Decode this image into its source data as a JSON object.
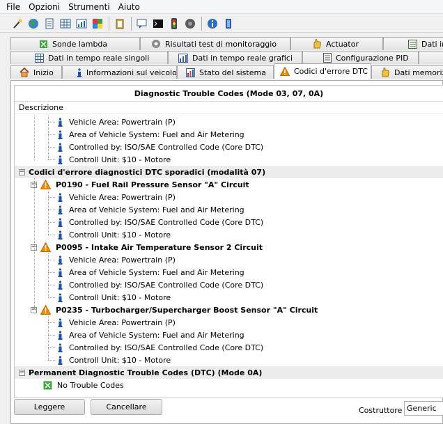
{
  "menu": [
    "File",
    "Opzioni",
    "Strumenti",
    "Aiuto"
  ],
  "toolbar_icons": [
    "wand-icon",
    "globe-icon",
    "document-icon",
    "grid-icon",
    "chart-icon",
    "color-palette-icon",
    "clipboard-icon",
    "chat-icon",
    "terminal-icon",
    "traffic-light-icon",
    "record-icon",
    "info-icon",
    "exit-icon"
  ],
  "tabs": {
    "row1": [
      "Sonde lambda",
      "Risultati test di monitoraggio",
      "Actuator",
      "Dati in"
    ],
    "row2": [
      "Dati in tempo reale singoli",
      "Dati in tempo reale grafici",
      "Configurazione PID",
      ""
    ],
    "row3": [
      "Inizio",
      "Informazioni sul veicolo",
      "Stato del sistema",
      "Codici d'errore DTC",
      "Dati memorizzati"
    ]
  },
  "tree": {
    "title": "Diagnostic Trouble Codes (Mode 03, 07, 0A)",
    "column": "Descrizione",
    "rows": [
      {
        "kind": "info",
        "text": "Vehicle Area: Powertrain (P)"
      },
      {
        "kind": "info",
        "text": "Area of Vehicle System: Fuel and Air Metering"
      },
      {
        "kind": "info",
        "text": "Controlled by: ISO/SAE Controlled Code (Core DTC)"
      },
      {
        "kind": "info",
        "text": "Controll Unit: $10 - Motore"
      },
      {
        "kind": "group",
        "text": "Codici d'errore diagnostici DTC sporadici (modalità 07)"
      },
      {
        "kind": "code",
        "text": "P0190 - Fuel Rail Pressure Sensor \"A\" Circuit"
      },
      {
        "kind": "info",
        "text": "Vehicle Area: Powertrain (P)"
      },
      {
        "kind": "info",
        "text": "Area of Vehicle System: Fuel and Air Metering"
      },
      {
        "kind": "info",
        "text": "Controlled by: ISO/SAE Controlled Code (Core DTC)"
      },
      {
        "kind": "info",
        "text": "Controll Unit: $10 - Motore"
      },
      {
        "kind": "code",
        "text": "P0095 - Intake Air Temperature Sensor 2 Circuit"
      },
      {
        "kind": "info",
        "text": "Vehicle Area: Powertrain (P)"
      },
      {
        "kind": "info",
        "text": "Area of Vehicle System: Fuel and Air Metering"
      },
      {
        "kind": "info",
        "text": "Controlled by: ISO/SAE Controlled Code (Core DTC)"
      },
      {
        "kind": "info",
        "text": "Controll Unit: $10 - Motore"
      },
      {
        "kind": "code",
        "text": "P0235 - Turbocharger/Supercharger Boost Sensor \"A\" Circuit"
      },
      {
        "kind": "info",
        "text": "Vehicle Area: Powertrain (P)"
      },
      {
        "kind": "info",
        "text": "Area of Vehicle System: Fuel and Air Metering"
      },
      {
        "kind": "info",
        "text": "Controlled by: ISO/SAE Controlled Code (Core DTC)"
      },
      {
        "kind": "info",
        "text": "Controll Unit: $10 - Motore"
      },
      {
        "kind": "group",
        "text": "Permanent Diagnostic Trouble Codes (DTC) (Mode 0A)"
      },
      {
        "kind": "ok",
        "text": "No Trouble Codes"
      }
    ]
  },
  "buttons": {
    "read": "Leggere",
    "clear": "Cancellare"
  },
  "manufacturer": {
    "label": "Costruttore",
    "value": "Generic"
  },
  "colors": {
    "warning": "#f08a00",
    "info": "#1f4fa8",
    "ok": "#3aa835"
  }
}
